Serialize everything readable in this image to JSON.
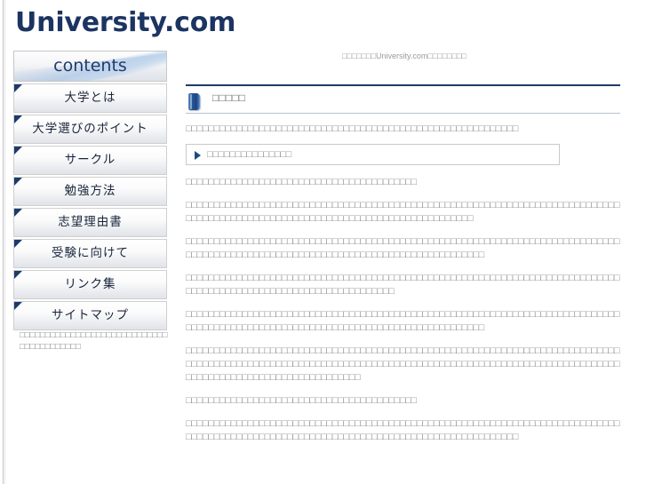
{
  "site": {
    "logo": "University.com",
    "tagline": "□□□□□□□University.com□□□□□□□□"
  },
  "sidebar": {
    "header": "contents",
    "items": [
      {
        "label": "大学とは"
      },
      {
        "label": "大学選びのポイント"
      },
      {
        "label": "サークル"
      },
      {
        "label": "勉強方法"
      },
      {
        "label": "志望理由書"
      },
      {
        "label": "受験に向けて"
      },
      {
        "label": "リンク集"
      },
      {
        "label": "サイトマップ"
      }
    ],
    "note": "□□□□□□□□□□□□□□□□□□□□□□□□□□□□□□□□□□□□□□□□□"
  },
  "main": {
    "section_title": "□□□□□",
    "intro_paragraph": "□□□□□□□□□□□□□□□□□□□□□□□□□□□□□□□□□□□□□□□□□□□□□□□□□□□□□□□□□□□",
    "callout": {
      "label": "□□□□□□□□□□□□□□□",
      "arrow_icon": "triangle-right-icon"
    },
    "paragraphs": [
      "□□□□□□□□□□□□□□□□□□□□□□□□□□□□□□□□□□□□□□□□□",
      "□□□□□□□□□□□□□□□□□□□□□□□□□□□□□□□□□□□□□□□□□□□□□□□□□□□□□□□□□□□□□□□□□□□□□□□□□□□□□□□□□□□□□□□□□□□□□□□□□□□□□□□□□□□□□□□□□□□□□□□□□□□□□□□□",
      "□□□□□□□□□□□□□□□□□□□□□□□□□□□□□□□□□□□□□□□□□□□□□□□□□□□□□□□□□□□□□□□□□□□□□□□□□□□□□□□□□□□□□□□□□□□□□□□□□□□□□□□□□□□□□□□□□□□□□□□□□□□□□□□□□□",
      "□□□□□□□□□□□□□□□□□□□□□□□□□□□□□□□□□□□□□□□□□□□□□□□□□□□□□□□□□□□□□□□□□□□□□□□□□□□□□□□□□□□□□□□□□□□□□□□□□□□□□□□□□□□□□□□□□□",
      "□□□□□□□□□□□□□□□□□□□□□□□□□□□□□□□□□□□□□□□□□□□□□□□□□□□□□□□□□□□□□□□□□□□□□□□□□□□□□□□□□□□□□□□□□□□□□□□□□□□□□□□□□□□□□□□□□□□□□□□□□□□□□□□□□□",
      "□□□□□□□□□□□□□□□□□□□□□□□□□□□□□□□□□□□□□□□□□□□□□□□□□□□□□□□□□□□□□□□□□□□□□□□□□□□□□□□□□□□□□□□□□□□□□□□□□□□□□□□□□□□□□□□□□□□□□□□□□□□□□□□□□□□□□□□□□□□□□□□□□□□□□□□□□□□□□□□□□□□□□□□□□□□□□□□□□□□□□□□□□",
      "□□□□□□□□□□□□□□□□□□□□□□□□□□□□□□□□□□□□□□□□□",
      "□□□□□□□□□□□□□□□□□□□□□□□□□□□□□□□□□□□□□□□□□□□□□□□□□□□□□□□□□□□□□□□□□□□□□□□□□□□□□□□□□□□□□□□□□□□□□□□□□□□□□□□□□□□□□□□□□□□□□□□□□□□□□□□□□□□□□□□□"
    ]
  },
  "colors": {
    "brand_navy": "#1c3461",
    "accent_blue": "#1e3a6a",
    "text_gray": "#8c8c8c",
    "border_gray": "#c9c9c9"
  }
}
